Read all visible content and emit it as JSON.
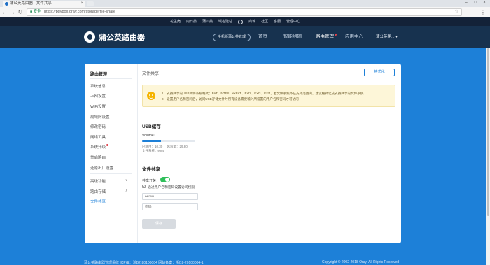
{
  "browser": {
    "tab_title": "蒲公英路由器 - 文件共享",
    "tab_close": "×",
    "url_secure_label": "安全",
    "url_rest": "https://pgybox.oray.com/storage/file-share",
    "url_scheme_display": "https://",
    "window_controls": [
      "–",
      "□",
      "×"
    ],
    "nav": {
      "back": "←",
      "forward": "→",
      "reload": "↻"
    }
  },
  "top_links": [
    "花生壳",
    "向日葵",
    "蒲公英",
    "域名建站",
    "商城",
    "社区",
    "客服",
    "管理中心"
  ],
  "header": {
    "brand": "蒲公英路由器",
    "pill_button": "手机版蒲公英管理",
    "nav": [
      {
        "label": "首页",
        "active": false
      },
      {
        "label": "智能组网",
        "active": false
      },
      {
        "label": "路由管理",
        "active": true,
        "dot": true
      },
      {
        "label": "应用中心",
        "active": false
      }
    ],
    "user": "蒲公英路... ▾"
  },
  "sidebar": {
    "title": "路由管理",
    "items": [
      {
        "label": "系统信息"
      },
      {
        "label": "上网设置"
      },
      {
        "label": "WiFi设置"
      },
      {
        "label": "局域网设置"
      },
      {
        "label": "修改密码"
      },
      {
        "label": "网络工具"
      },
      {
        "label": "系统升级",
        "dot": true
      },
      {
        "label": "重启路由"
      },
      {
        "label": "还原出厂设置"
      }
    ],
    "groups": [
      {
        "label": "高级功能",
        "caret": "∨"
      },
      {
        "label": "路由存储",
        "caret": "∧"
      }
    ],
    "active_item": "文件共享"
  },
  "content": {
    "breadcrumb": "文件共享",
    "format_button": "格式化",
    "notice": {
      "line1": "1、支持共享的USB文件系统格式：FAT、NTFS、exFAT、Ext2、Ext3、Ext4，若文件系统不在支持范围内，建议格式化成支持共享的文件系统",
      "line2": "2、设置用户名和密码后，访问USB存储文件时所有设备需要输入所设置的用户名和密码才可访问"
    },
    "usb": {
      "title": "USB储存",
      "volume_name": "Volume1",
      "used_label": "已使用：",
      "used_value": "10.30",
      "total_label": "总容量：",
      "total_value": "29.80",
      "fs_label": "文件系统：",
      "fs_value": "ext4",
      "usage_fraction": 0.35
    },
    "share": {
      "title": "文件共享",
      "switch_label": "共享开关：",
      "switch_on": true,
      "checkbox_label": "通过用户名和密码设置访问权限",
      "checkbox_mark": "✓",
      "username_value": "admin",
      "password_placeholder": "密码",
      "save_button": "保存"
    }
  },
  "footer": {
    "left": "蒲公英路由器管理系统 ICP备：浙B2-20100004  网站备案：浙B2-20100004-1",
    "right": "Copyright © 2002-2018 Oray. All Rights Reserved"
  }
}
